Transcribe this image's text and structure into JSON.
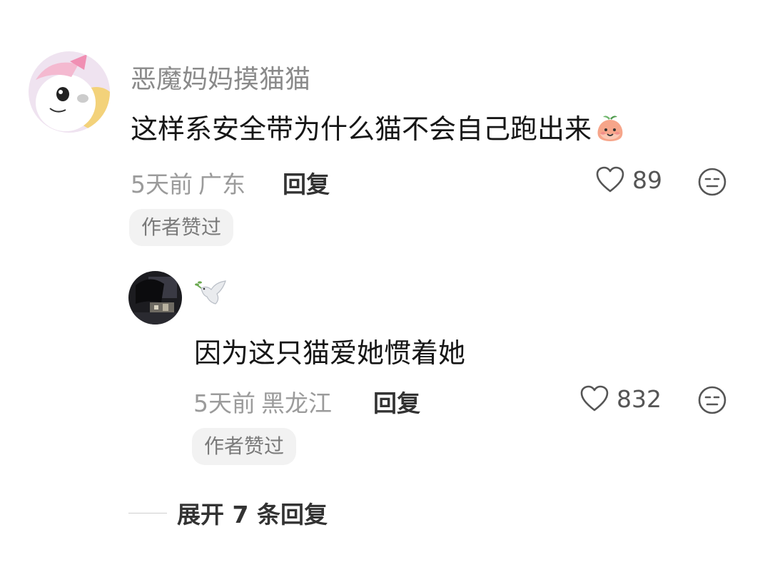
{
  "comments": [
    {
      "username": "恶魔妈妈摸猫猫",
      "text": "这样系安全带为什么猫不会自己跑出来",
      "emoji": "peach-face-emoji",
      "time": "5天前",
      "location": "广东",
      "reply_label": "回复",
      "likes": "89",
      "badge": "作者赞过"
    },
    {
      "username": "🕊",
      "text": "因为这只猫爱她惯着她",
      "time": "5天前",
      "location": "黑龙江",
      "reply_label": "回复",
      "likes": "832",
      "badge": "作者赞过"
    }
  ],
  "expand_label": "展开 7 条回复",
  "colors": {
    "secondary_text": "#9b9b9b",
    "badge_bg": "#f2f2f2",
    "icon_gray": "#555555"
  }
}
